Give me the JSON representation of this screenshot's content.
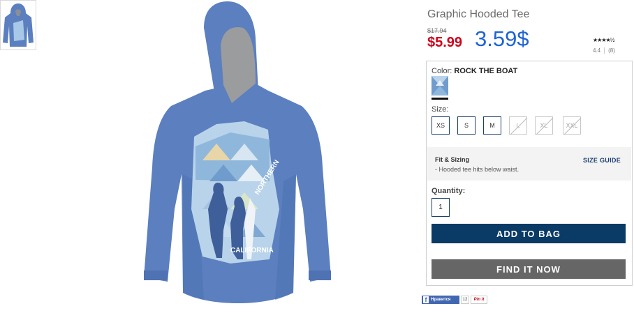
{
  "product": {
    "title": "Graphic Hooded Tee",
    "was_price": "$17.94",
    "sale_price": "$5.99",
    "handwritten_price": "3.59$",
    "stars": "★★★★½",
    "rating": "4.4",
    "review_count": "(8)",
    "image_graphic_words": [
      "NORTHERN",
      "CALIFORNIA"
    ]
  },
  "color": {
    "label": "Color:",
    "value": "ROCK THE BOAT"
  },
  "size": {
    "label": "Size:",
    "options": [
      {
        "label": "XS",
        "available": true
      },
      {
        "label": "S",
        "available": true
      },
      {
        "label": "M",
        "available": true
      },
      {
        "label": "L",
        "available": false
      },
      {
        "label": "XL",
        "available": false
      },
      {
        "label": "XXL",
        "available": false
      }
    ]
  },
  "fit": {
    "title": "Fit & Sizing",
    "note": "- Hooded tee hits below waist.",
    "guide_link": "SIZE GUIDE"
  },
  "quantity": {
    "label": "Quantity:",
    "value": "1"
  },
  "actions": {
    "add_to_bag": "ADD TO BAG",
    "find_it_now": "FIND IT NOW"
  },
  "social": {
    "like": "Нравится",
    "like_count": "12",
    "pin": "Pin it"
  },
  "colors": {
    "accent": "#0a3a66",
    "sale": "#d0021b",
    "handwritten": "#1f63d6",
    "find_button": "#666666",
    "hoodie": "#5b7fbf"
  }
}
